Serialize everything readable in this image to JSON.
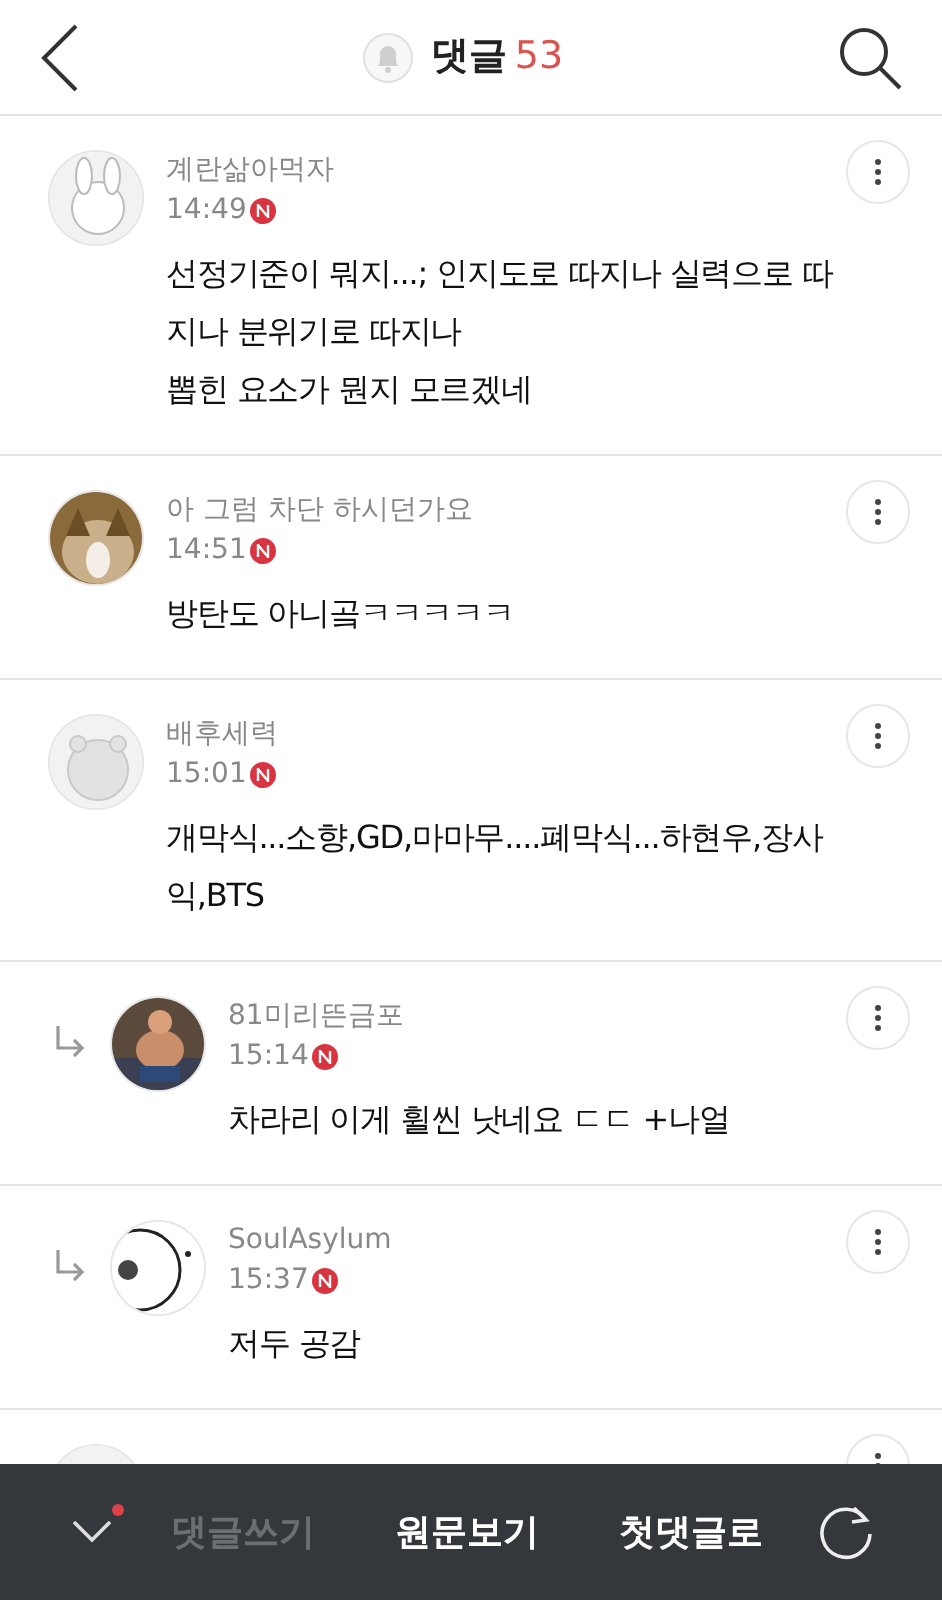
{
  "header": {
    "title": "댓글",
    "count": "53"
  },
  "comments": [
    {
      "kind": "comment",
      "author": "계란삶아먹자",
      "time": "14:49",
      "is_new": true,
      "text": "선정기준이 뭐지...; 인지도로 따지나 실력으로 따지나 분위기로 따지나\n뽑힌 요소가 뭔지 모르겠네"
    },
    {
      "kind": "comment",
      "author": "아 그럼 차단 하시던가요",
      "time": "14:51",
      "is_new": true,
      "text": "방탄도 아니곸ㅋㅋㅋㅋㅋ"
    },
    {
      "kind": "comment",
      "author": "배후세력",
      "time": "15:01",
      "is_new": true,
      "text": "개막식...소향,GD,마마무....폐막식...하현우,장사익,BTS"
    },
    {
      "kind": "reply",
      "author": "81미리뜬금포",
      "time": "15:14",
      "is_new": true,
      "text": "차라리 이게 휠씬 낫네요 ㄷㄷ +나얼"
    },
    {
      "kind": "reply",
      "author": "SoulAsylum",
      "time": "15:37",
      "is_new": true,
      "text": "저두 공감"
    },
    {
      "kind": "comment"
    }
  ],
  "bottom_bar": {
    "collapse_alert": true,
    "actions": [
      {
        "label": "댓글쓰기",
        "disabled": true
      },
      {
        "label": "원문보기",
        "disabled": false
      },
      {
        "label": "첫댓글로",
        "disabled": false
      }
    ]
  }
}
